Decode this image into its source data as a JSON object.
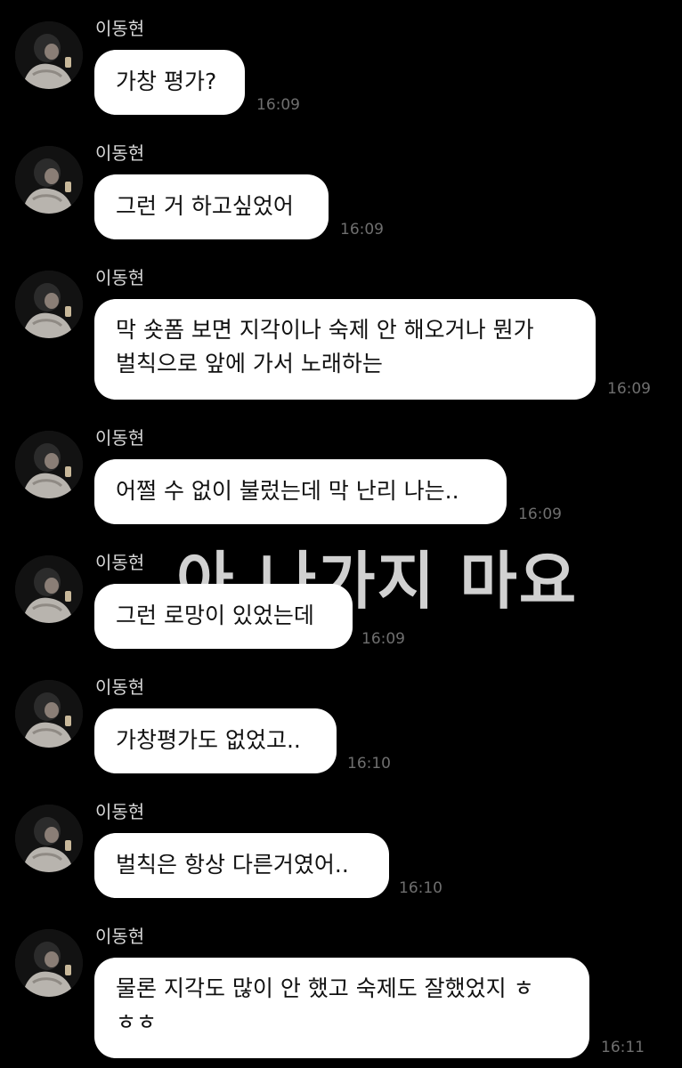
{
  "overlay_text": "아 나가지 마요",
  "messages": [
    {
      "sender": "이동현",
      "lines": [
        "가창 평가?"
      ],
      "time": "16:09"
    },
    {
      "sender": "이동현",
      "lines": [
        "그런 거 하고싶었어"
      ],
      "time": "16:09"
    },
    {
      "sender": "이동현",
      "lines": [
        "막 숏폼 보면 지각이나 숙제 안 해오거나 뭔가",
        "벌칙으로 앞에 가서 노래하는"
      ],
      "time": "16:09"
    },
    {
      "sender": "이동현",
      "lines": [
        "어쩔 수 없이 불렀는데 막 난리 나는.."
      ],
      "time": "16:09"
    },
    {
      "sender": "이동현",
      "lines": [
        "그런 로망이 있었는데"
      ],
      "time": "16:09"
    },
    {
      "sender": "이동현",
      "lines": [
        "가창평가도 없었고.."
      ],
      "time": "16:10"
    },
    {
      "sender": "이동현",
      "lines": [
        "벌칙은 항상 다른거였어.."
      ],
      "time": "16:10"
    },
    {
      "sender": "이동현",
      "lines": [
        "물론 지각도 많이 안 했고 숙제도 잘했었지 ㅎ",
        "ㅎㅎ"
      ],
      "time": "16:11"
    }
  ]
}
